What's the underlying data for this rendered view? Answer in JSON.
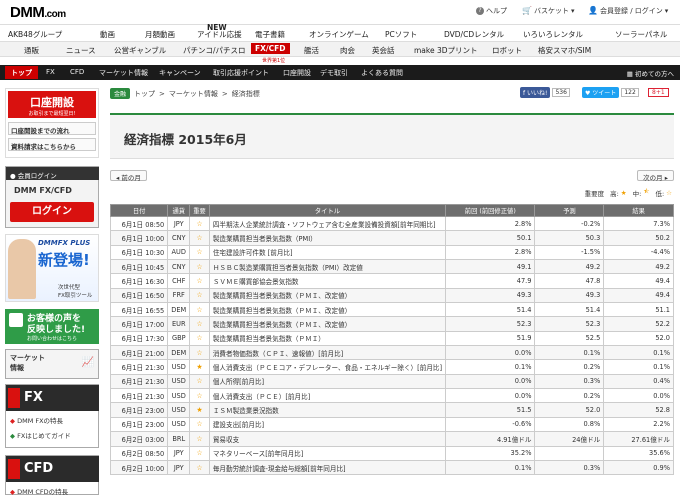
{
  "header": {
    "logo_main": "DMM",
    "logo_sub": ".com",
    "help": "ヘルプ",
    "basket": "バスケット",
    "login": "会員登録 / ログイン"
  },
  "services": [
    "AKB48グループ",
    "動画",
    "月額動画",
    "アイドル応援",
    "電子書籍",
    "オンラインゲーム",
    "PCソフト",
    "DVD/CDレンタル",
    "いろいろレンタル",
    "ソーラーパネル"
  ],
  "services_new": "NEW",
  "subservices": [
    "通販",
    "ニュース",
    "公営ギャンブル",
    "パチンコ/パチスロ",
    "FX/CFD",
    "艦活",
    "肉会",
    "英会話",
    "make 3Dプリント",
    "ロボット",
    "格安スマホ/SIM"
  ],
  "subservice_note": "世界第1位",
  "nav": [
    "トップ",
    "FX",
    "CFD",
    "マーケット情報",
    "キャンペーン",
    "取引応援ポイント",
    "口座開設",
    "デモ取引",
    "よくある質問"
  ],
  "nav_first": "初めての方へ",
  "sidebar": {
    "open_account": "口座開設",
    "open_sub": "お取引まで最短翌日!",
    "flow": "口座開設までの流れ",
    "docs": "資料請求はこちらから",
    "member_login": "会員ログイン",
    "brand": "DMM FX/CFD",
    "login_btn": "ログイン",
    "promo_brand": "DMMFX PLUS",
    "promo_big": "新登場!",
    "promo_sub": "次世代型",
    "promo_sub2": "FX取引ツール",
    "voice1": "お客様の声を",
    "voice2": "反映しました!",
    "voice3": "お問い合わせはこちら",
    "market": "マーケット",
    "market2": "情報",
    "fx": "FX",
    "fx_item1": "DMM FXの特長",
    "fx_item2": "FXはじめてガイド",
    "cfd": "CFD",
    "cfd_item1": "DMM CFDの特長"
  },
  "breadcrumb": {
    "tag": "金融",
    "items": [
      "トップ",
      "マーケット情報",
      "経済指標"
    ],
    "sep": ">"
  },
  "social": {
    "like": "いいね!",
    "like_count": "536",
    "tweet": "ツイート",
    "tweet_count": "122",
    "gplus": "8+1"
  },
  "page_title": "経済指標 2015年6月",
  "prev": "前の月",
  "next": "次の月",
  "importance_legend": {
    "label": "重要度",
    "high": "高:",
    "mid": "中:",
    "low": "低:"
  },
  "table": {
    "headers": [
      "日付",
      "通貨",
      "重要",
      "タイトル",
      "前回 (前回修正値)",
      "予測",
      "結果"
    ],
    "rows": [
      {
        "date": "6月1日 08:50",
        "cur": "JPY",
        "imp": "low",
        "title": "四半期法人企業統計調査・ソフトウェア含む全産業設備投資額[前年同期比]",
        "prev": "2.8%",
        "fc": "-0.2%",
        "res": "7.3%"
      },
      {
        "date": "6月1日 10:00",
        "cur": "CNY",
        "imp": "low",
        "title": "製造業購買担当者景気指数（PMI）",
        "prev": "50.1",
        "fc": "50.3",
        "res": "50.2"
      },
      {
        "date": "6月1日 10:30",
        "cur": "AUD",
        "imp": "low",
        "title": "住宅建設許可件数 [前月比]",
        "prev": "2.8%",
        "fc": "-1.5%",
        "res": "-4.4%"
      },
      {
        "date": "6月1日 10:45",
        "cur": "CNY",
        "imp": "low",
        "title": "ＨＳＢＣ製造業購買担当者景気指数（PMI）改定値",
        "prev": "49.1",
        "fc": "49.2",
        "res": "49.2"
      },
      {
        "date": "6月1日 16:30",
        "cur": "CHF",
        "imp": "low",
        "title": "ＳＶＭＥ購買部協会景気指数",
        "prev": "47.9",
        "fc": "47.8",
        "res": "49.4"
      },
      {
        "date": "6月1日 16:50",
        "cur": "FRF",
        "imp": "low",
        "title": "製造業購買担当者景気指数（ＰＭＩ、改定値）",
        "prev": "49.3",
        "fc": "49.3",
        "res": "49.4"
      },
      {
        "date": "6月1日 16:55",
        "cur": "DEM",
        "imp": "low",
        "title": "製造業購買担当者景気指数（ＰＭＩ、改定値）",
        "prev": "51.4",
        "fc": "51.4",
        "res": "51.1"
      },
      {
        "date": "6月1日 17:00",
        "cur": "EUR",
        "imp": "low",
        "title": "製造業購買担当者景気指数（ＰＭＩ、改定値）",
        "prev": "52.3",
        "fc": "52.3",
        "res": "52.2"
      },
      {
        "date": "6月1日 17:30",
        "cur": "GBP",
        "imp": "low",
        "title": "製造業購買担当者景気指数（ＰＭＩ）",
        "prev": "51.9",
        "fc": "52.5",
        "res": "52.0"
      },
      {
        "date": "6月1日 21:00",
        "cur": "DEM",
        "imp": "low",
        "title": "消費者物価指数（ＣＰＩ、速報値）[前月比]",
        "prev": "0.0%",
        "fc": "0.1%",
        "res": "0.1%"
      },
      {
        "date": "6月1日 21:30",
        "cur": "USD",
        "imp": "high",
        "title": "個人消費支出（ＰＣＥコア・デフレーター、食品・エネルギー除く）[前月比]",
        "prev": "0.1%",
        "fc": "0.2%",
        "res": "0.1%"
      },
      {
        "date": "6月1日 21:30",
        "cur": "USD",
        "imp": "low",
        "title": "個人所得[前月比]",
        "prev": "0.0%",
        "fc": "0.3%",
        "res": "0.4%"
      },
      {
        "date": "6月1日 21:30",
        "cur": "USD",
        "imp": "low",
        "title": "個人消費支出（ＰＣＥ）[前月比]",
        "prev": "0.0%",
        "fc": "0.2%",
        "res": "0.0%"
      },
      {
        "date": "6月1日 23:00",
        "cur": "USD",
        "imp": "high",
        "title": "ＩＳＭ製造業景況指数",
        "prev": "51.5",
        "fc": "52.0",
        "res": "52.8"
      },
      {
        "date": "6月1日 23:00",
        "cur": "USD",
        "imp": "low",
        "title": "建設支出[前月比]",
        "prev": "-0.6%",
        "fc": "0.8%",
        "res": "2.2%"
      },
      {
        "date": "6月2日 03:00",
        "cur": "BRL",
        "imp": "low",
        "title": "貿易収支",
        "prev": "4.91億ドル",
        "fc": "24億ドル",
        "res": "27.61億ドル"
      },
      {
        "date": "6月2日 08:50",
        "cur": "JPY",
        "imp": "low",
        "title": "マネタリーベース[前年同月比]",
        "prev": "35.2%",
        "fc": "",
        "res": "35.6%"
      },
      {
        "date": "6月2日 10:00",
        "cur": "JPY",
        "imp": "low",
        "title": "毎月勤労統計調査-現金給与総額[前年同月比]",
        "prev": "0.1%",
        "fc": "0.3%",
        "res": "0.9%"
      }
    ]
  }
}
